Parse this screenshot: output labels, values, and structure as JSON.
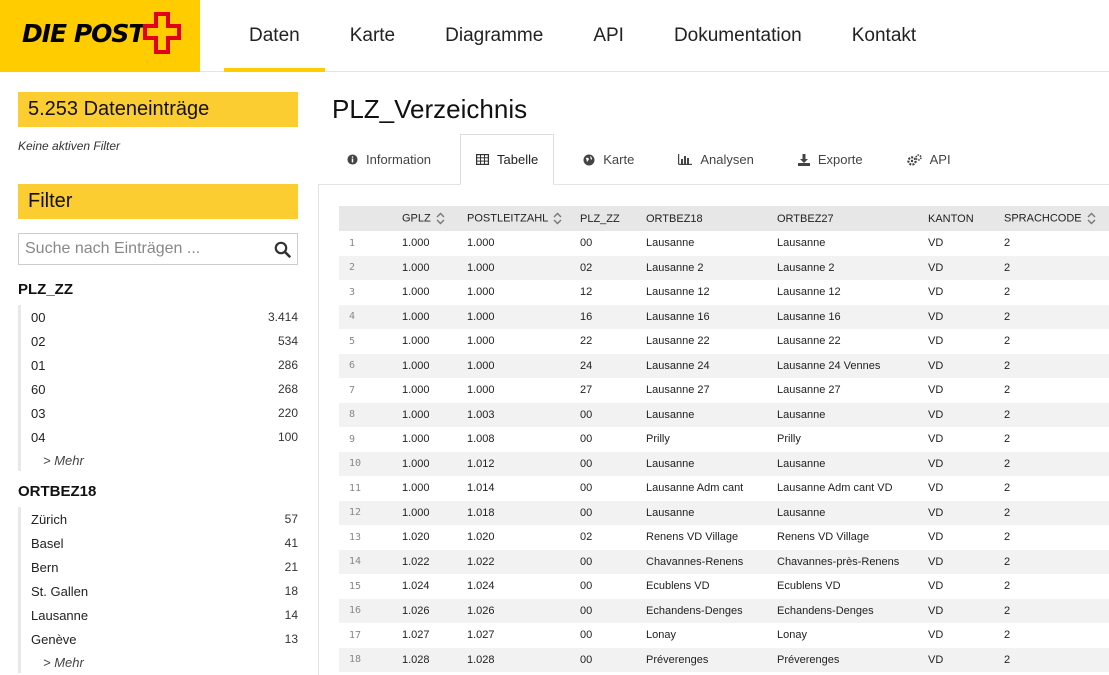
{
  "header": {
    "logo_text": "DIE POST",
    "nav": [
      {
        "label": "Daten",
        "active": true
      },
      {
        "label": "Karte",
        "active": false
      },
      {
        "label": "Diagramme",
        "active": false
      },
      {
        "label": "API",
        "active": false
      },
      {
        "label": "Dokumentation",
        "active": false
      },
      {
        "label": "Kontakt",
        "active": false
      }
    ]
  },
  "sidebar": {
    "count_label": "5.253 Dateneinträge",
    "no_filter": "Keine aktiven Filter",
    "filter_label": "Filter",
    "search_placeholder": "Suche nach Einträgen ...",
    "facets": [
      {
        "title": "PLZ_ZZ",
        "items": [
          {
            "label": "00",
            "count": "3.414"
          },
          {
            "label": "02",
            "count": "534"
          },
          {
            "label": "01",
            "count": "286"
          },
          {
            "label": "60",
            "count": "268"
          },
          {
            "label": "03",
            "count": "220"
          },
          {
            "label": "04",
            "count": "100"
          }
        ],
        "more": "> Mehr"
      },
      {
        "title": "ORTBEZ18",
        "items": [
          {
            "label": "Zürich",
            "count": "57"
          },
          {
            "label": "Basel",
            "count": "41"
          },
          {
            "label": "Bern",
            "count": "21"
          },
          {
            "label": "St. Gallen",
            "count": "18"
          },
          {
            "label": "Lausanne",
            "count": "14"
          },
          {
            "label": "Genève",
            "count": "13"
          }
        ],
        "more": "> Mehr"
      }
    ]
  },
  "main": {
    "title": "PLZ_Verzeichnis",
    "tabs": [
      {
        "label": "Information",
        "icon": "info-circle-icon",
        "active": false
      },
      {
        "label": "Tabelle",
        "icon": "table-icon",
        "active": true
      },
      {
        "label": "Karte",
        "icon": "globe-icon",
        "active": false
      },
      {
        "label": "Analysen",
        "icon": "bar-chart-icon",
        "active": false
      },
      {
        "label": "Exporte",
        "icon": "download-icon",
        "active": false
      },
      {
        "label": "API",
        "icon": "gears-icon",
        "active": false
      }
    ]
  },
  "table": {
    "columns": [
      "GPLZ",
      "POSTLEITZAHL",
      "PLZ_ZZ",
      "ORTBEZ18",
      "ORTBEZ27",
      "KANTON",
      "SPRACHCODE"
    ],
    "sortable": [
      true,
      true,
      false,
      false,
      false,
      false,
      true
    ],
    "rows": [
      [
        "1",
        "1.000",
        "1.000",
        "00",
        "Lausanne",
        "Lausanne",
        "VD",
        "2"
      ],
      [
        "2",
        "1.000",
        "1.000",
        "02",
        "Lausanne 2",
        "Lausanne 2",
        "VD",
        "2"
      ],
      [
        "3",
        "1.000",
        "1.000",
        "12",
        "Lausanne 12",
        "Lausanne 12",
        "VD",
        "2"
      ],
      [
        "4",
        "1.000",
        "1.000",
        "16",
        "Lausanne 16",
        "Lausanne 16",
        "VD",
        "2"
      ],
      [
        "5",
        "1.000",
        "1.000",
        "22",
        "Lausanne 22",
        "Lausanne 22",
        "VD",
        "2"
      ],
      [
        "6",
        "1.000",
        "1.000",
        "24",
        "Lausanne 24",
        "Lausanne 24 Vennes",
        "VD",
        "2"
      ],
      [
        "7",
        "1.000",
        "1.000",
        "27",
        "Lausanne 27",
        "Lausanne 27",
        "VD",
        "2"
      ],
      [
        "8",
        "1.000",
        "1.003",
        "00",
        "Lausanne",
        "Lausanne",
        "VD",
        "2"
      ],
      [
        "9",
        "1.000",
        "1.008",
        "00",
        "Prilly",
        "Prilly",
        "VD",
        "2"
      ],
      [
        "10",
        "1.000",
        "1.012",
        "00",
        "Lausanne",
        "Lausanne",
        "VD",
        "2"
      ],
      [
        "11",
        "1.000",
        "1.014",
        "00",
        "Lausanne Adm cant",
        "Lausanne Adm cant VD",
        "VD",
        "2"
      ],
      [
        "12",
        "1.000",
        "1.018",
        "00",
        "Lausanne",
        "Lausanne",
        "VD",
        "2"
      ],
      [
        "13",
        "1.020",
        "1.020",
        "02",
        "Renens VD Village",
        "Renens VD Village",
        "VD",
        "2"
      ],
      [
        "14",
        "1.022",
        "1.022",
        "00",
        "Chavannes-Renens",
        "Chavannes-près-Renens",
        "VD",
        "2"
      ],
      [
        "15",
        "1.024",
        "1.024",
        "00",
        "Ecublens VD",
        "Ecublens VD",
        "VD",
        "2"
      ],
      [
        "16",
        "1.026",
        "1.026",
        "00",
        "Echandens-Denges",
        "Echandens-Denges",
        "VD",
        "2"
      ],
      [
        "17",
        "1.027",
        "1.027",
        "00",
        "Lonay",
        "Lonay",
        "VD",
        "2"
      ],
      [
        "18",
        "1.028",
        "1.028",
        "00",
        "Préverenges",
        "Préverenges",
        "VD",
        "2"
      ]
    ]
  },
  "colors": {
    "brand_yellow": "#ffcc00",
    "filter_yellow": "#fccd31",
    "logo_red": "#e2001a"
  }
}
